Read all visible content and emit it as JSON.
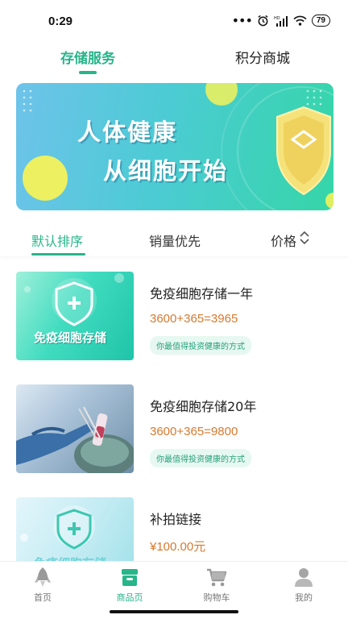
{
  "status_bar": {
    "time": "0:29",
    "battery": "79"
  },
  "top_tabs": [
    {
      "label": "存储服务",
      "active": true
    },
    {
      "label": "积分商城",
      "active": false
    }
  ],
  "banner": {
    "line1": "人体健康",
    "line2": "从细胞开始"
  },
  "sort_bar": {
    "default": "默认排序",
    "sales": "销量优先",
    "price": "价格"
  },
  "products": [
    {
      "name": "免疫细胞存储一年",
      "price": "3600+365=3965",
      "tag": "你最值得投资健康的方式",
      "thumb_text": "免疫细胞存储"
    },
    {
      "name": "免疫细胞存储20年",
      "price": "3600+365=9800",
      "tag": "你最值得投资健康的方式"
    },
    {
      "name": "补拍链接",
      "price": "¥100.00元",
      "thumb_text": "免疫细胞存储"
    }
  ],
  "bottom_nav": [
    {
      "label": "首页",
      "icon": "rocket-icon",
      "active": false
    },
    {
      "label": "商品页",
      "icon": "store-icon",
      "active": true
    },
    {
      "label": "购物车",
      "icon": "cart-icon",
      "active": false
    },
    {
      "label": "我的",
      "icon": "user-icon",
      "active": false
    }
  ],
  "colors": {
    "accent": "#27b58a",
    "price": "#d5792e"
  }
}
